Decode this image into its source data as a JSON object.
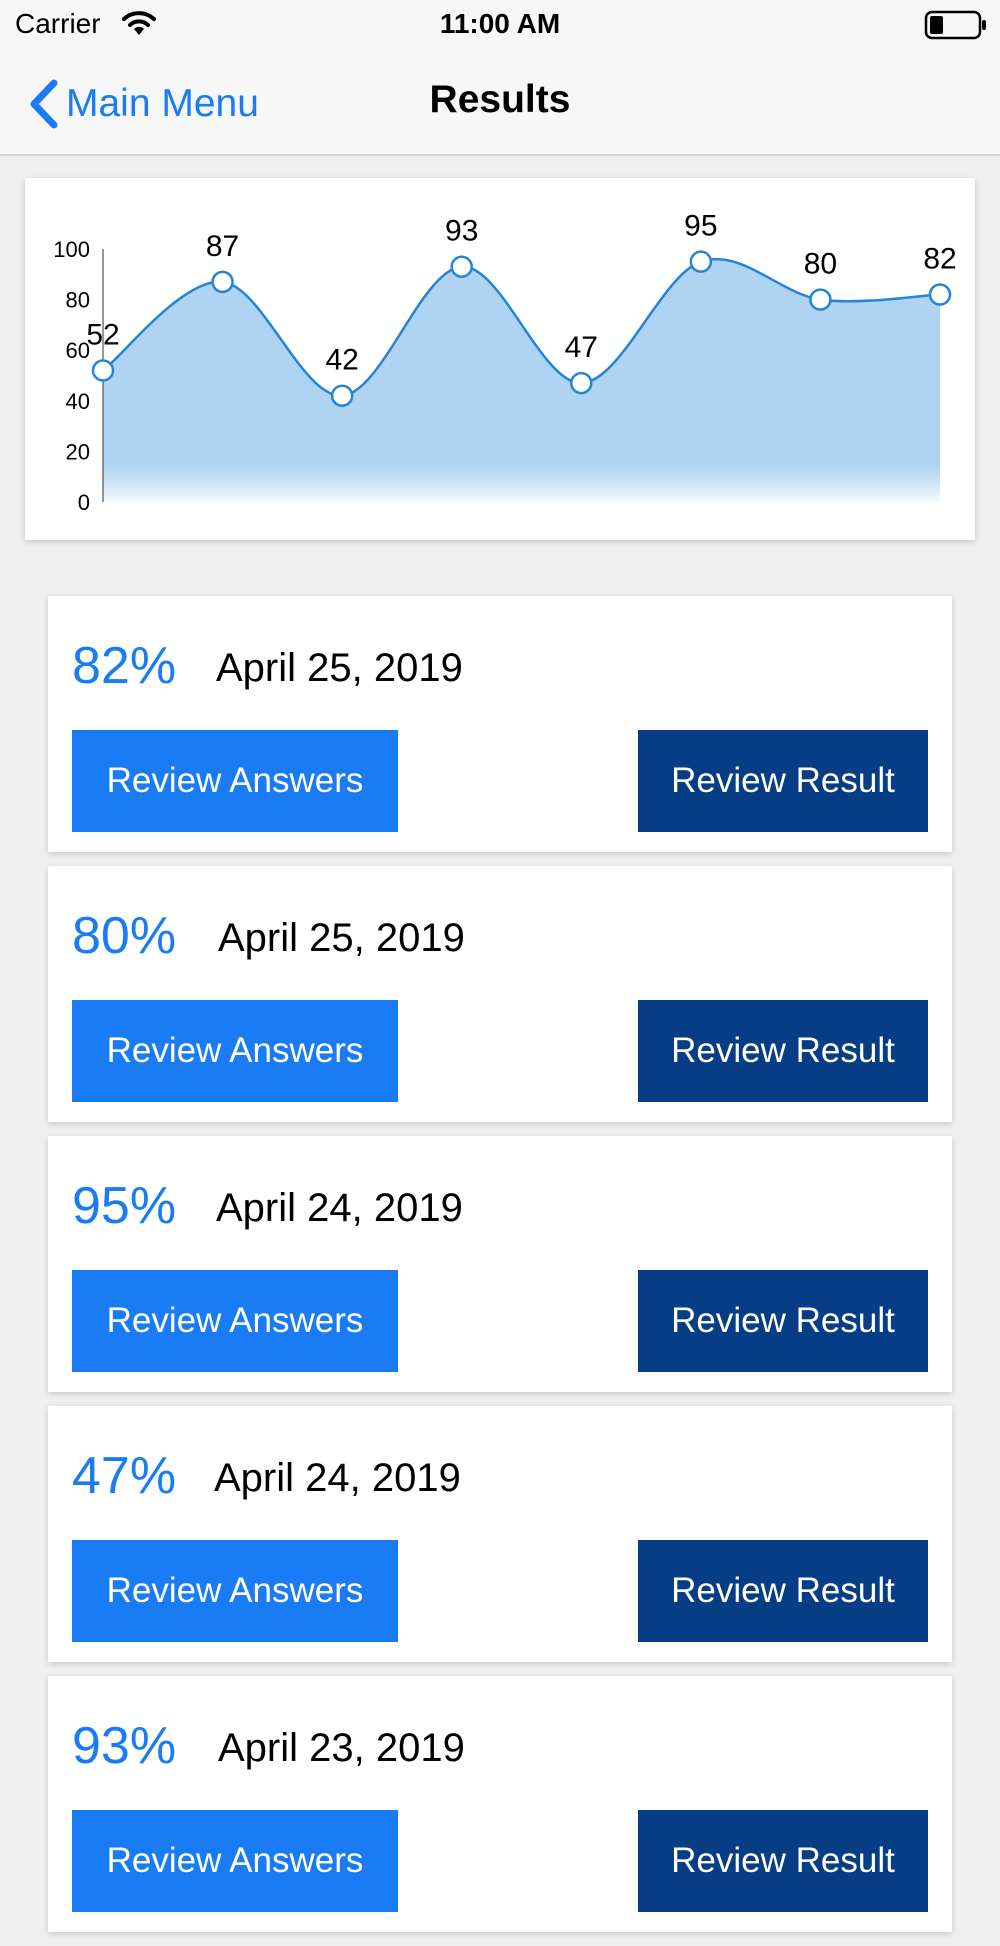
{
  "status_bar": {
    "carrier": "Carrier",
    "time": "11:00 AM"
  },
  "nav": {
    "back_label": "Main Menu",
    "title": "Results"
  },
  "colors": {
    "accent": "#1a7cf5",
    "dark_button": "#063d85",
    "chart_fill": "#aed4f1",
    "chart_line": "#2584d8"
  },
  "chart_data": {
    "type": "area",
    "x": [
      1,
      2,
      3,
      4,
      5,
      6,
      7,
      8
    ],
    "values": [
      52,
      87,
      42,
      93,
      47,
      95,
      80,
      82
    ],
    "data_labels": [
      "52",
      "87",
      "42",
      "93",
      "47",
      "95",
      "80",
      "82"
    ],
    "ylim": [
      0,
      100
    ],
    "y_ticks": [
      "0",
      "20",
      "40",
      "60",
      "80",
      "100"
    ],
    "grid": false,
    "smooth": true
  },
  "results": [
    {
      "percent": "82%",
      "date": "April 25, 2019",
      "answers_label": "Review Answers",
      "result_label": "Review Result"
    },
    {
      "percent": "80%",
      "date": "April 25, 2019",
      "answers_label": "Review Answers",
      "result_label": "Review Result"
    },
    {
      "percent": "95%",
      "date": "April 24, 2019",
      "answers_label": "Review Answers",
      "result_label": "Review Result"
    },
    {
      "percent": "47%",
      "date": "April 24, 2019",
      "answers_label": "Review Answers",
      "result_label": "Review Result"
    },
    {
      "percent": "93%",
      "date": "April 23, 2019",
      "answers_label": "Review Answers",
      "result_label": "Review Result"
    }
  ]
}
